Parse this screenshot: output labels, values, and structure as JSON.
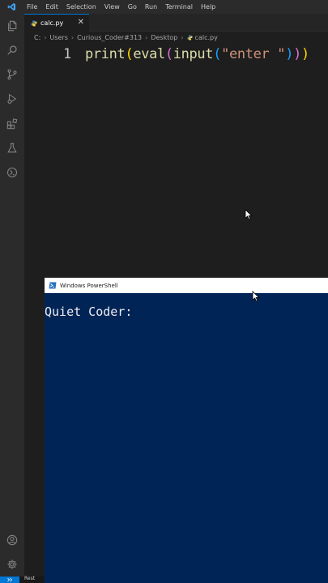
{
  "menubar": {
    "items": [
      "File",
      "Edit",
      "Selection",
      "View",
      "Go",
      "Run",
      "Terminal",
      "Help"
    ]
  },
  "activity_bar": {
    "items": [
      "explorer-icon",
      "search-icon",
      "source-control-icon",
      "run-debug-icon",
      "extensions-icon",
      "testing-icon",
      "remote-icon"
    ],
    "bottom": [
      "account-icon",
      "manage-gear-icon"
    ]
  },
  "editor": {
    "tab": {
      "label": "calc.py",
      "close": "✕"
    },
    "breadcrumb": [
      "C:",
      "Users",
      "Curious_Coder#313",
      "Desktop",
      "calc.py"
    ],
    "line_number": "1",
    "code": {
      "fn1": "print",
      "p1_open": "(",
      "fn2": "eval",
      "p2_open": "(",
      "fn3": "input",
      "p3_open": "(",
      "string": "\"enter \"",
      "p3_close": ")",
      "p2_close": ")",
      "p1_close": ")"
    }
  },
  "powershell": {
    "title": "Windows PowerShell",
    "prompt": "Quiet Coder:"
  },
  "statusbar": {
    "text": "Rest"
  },
  "colors": {
    "editor_bg": "#1e1e1e",
    "chrome_bg": "#2b2b2b",
    "accent": "#0078d4",
    "powershell_bg": "#012456",
    "function": "#dcdcaa",
    "string": "#ce9178"
  }
}
